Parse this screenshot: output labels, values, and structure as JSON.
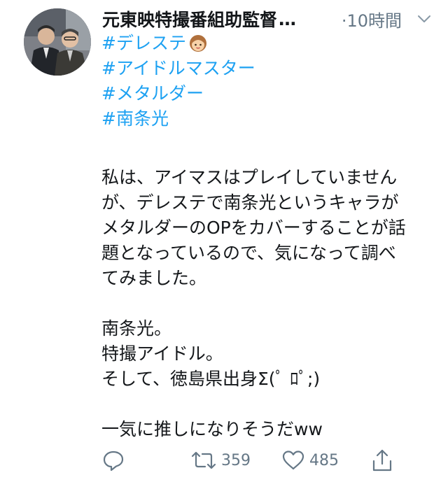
{
  "tweet": {
    "author": "元東映特撮番組助監督",
    "author_truncation": "…",
    "time": "·10時間",
    "hashtags": [
      "#デレステ",
      "#アイドルマスター",
      "#メタルダー",
      "#南条光"
    ],
    "paragraph1": [
      "私は、アイマスはプレイしていません",
      "が、デレステで南条光というキャラが",
      "メタルダーのOPをカバーすることが話",
      "題となっているので、気になって調べ",
      "てみました。"
    ],
    "paragraph2": [
      "南条光。",
      "特撮アイドル。",
      "そして、徳島県出身Σ(ﾟ ﾛﾟ;)"
    ],
    "paragraph3": [
      "一気に推しになりそうだww"
    ]
  },
  "actions": {
    "reply_icon": "reply-icon",
    "retweet_icon": "retweet-icon",
    "retweet_count": "359",
    "like_icon": "heart-icon",
    "like_count": "485",
    "share_icon": "share-icon"
  },
  "colors": {
    "hashtag": "#1da1f2",
    "meta": "#657786",
    "text": "#14171a"
  }
}
